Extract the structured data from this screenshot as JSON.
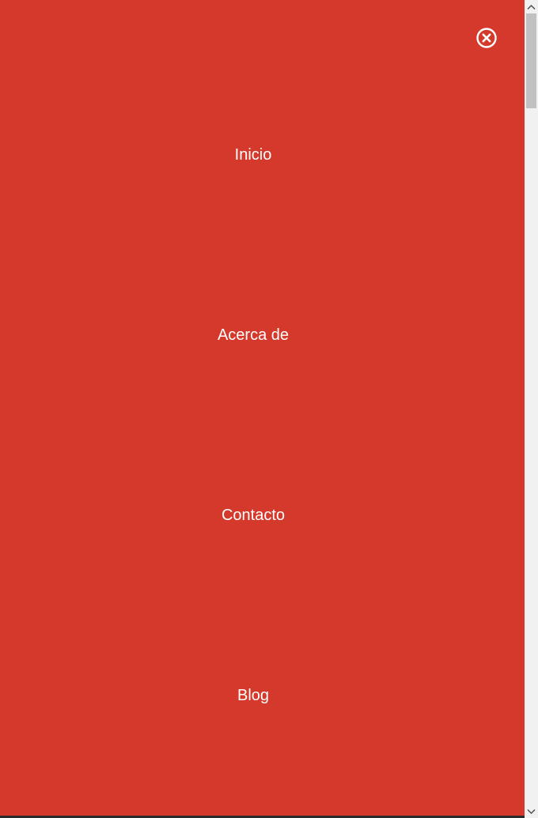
{
  "menu": {
    "background_color": "#d5392b",
    "text_color": "#ffffff",
    "close_icon": "close-circle-icon",
    "items": [
      {
        "label": "Inicio"
      },
      {
        "label": "Acerca de"
      },
      {
        "label": "Contacto"
      },
      {
        "label": "Blog"
      }
    ]
  },
  "scrollbar": {
    "up_icon": "chevron-up-icon",
    "down_icon": "chevron-down-icon"
  }
}
